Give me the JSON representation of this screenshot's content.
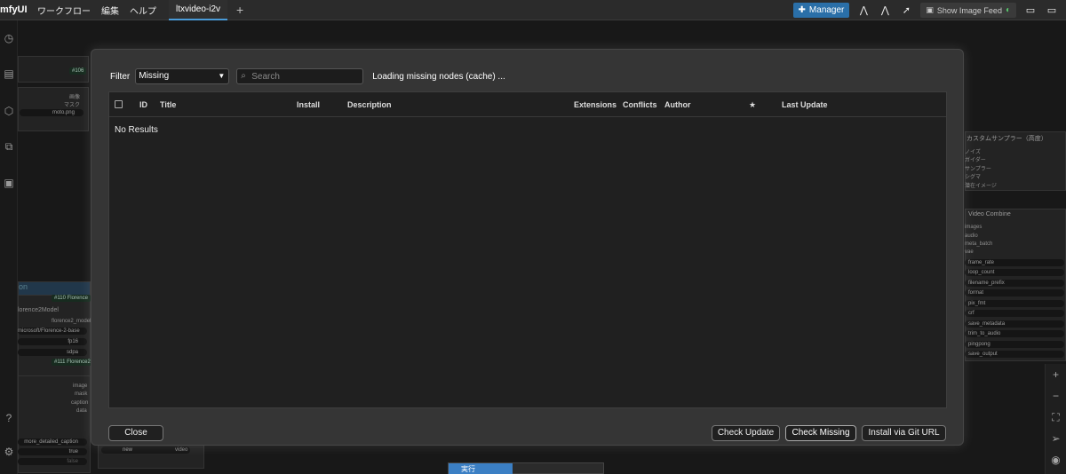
{
  "app": {
    "logo": "mfyUI"
  },
  "menu": [
    "ワークフロー",
    "編集",
    "ヘルプ"
  ],
  "tabs": [
    {
      "label": "ltxvideo-i2v"
    }
  ],
  "toolbar": {
    "manager_label": "Manager",
    "feed_label": "Show Image Feed"
  },
  "background_nodes": {
    "id_106": "#106",
    "image_label": "画像",
    "mask_label": "マスク",
    "file_value": "moto.png",
    "node_partial_title": "on",
    "id_110": "#110 Florence",
    "florence_title": "lorence2Model",
    "florence_model_label": "florence2_model",
    "florence_model_value": "microsoft/Florence-2-base",
    "fp_value": "fp16",
    "attn_value": "sdpa",
    "id_111": "#111 Florence2",
    "out_image": "image",
    "out_mask": "mask",
    "out_caption": "caption",
    "out_data": "data",
    "caption_value": "more_detailed_caption",
    "true_value": "true",
    "false_value": "false",
    "new_label": "new",
    "video_label": "video",
    "sampler_title": "カスタムサンプラー（高度）",
    "sampler_inputs": [
      "ノイズ",
      "ガイダー",
      "サンプラー",
      "シグマ",
      "潜在イメージ"
    ],
    "vc_title": "Video Combine",
    "vc_inputs": [
      "images",
      "audio",
      "meta_batch",
      "vae"
    ],
    "vc_widgets": [
      "frame_rate",
      "loop_count",
      "filename_prefix",
      "format",
      "pix_fmt",
      "crf",
      "save_metadata",
      "trim_to_audio",
      "pingpong",
      "save_output"
    ]
  },
  "dialog": {
    "filter_label": "Filter",
    "filter_value": "Missing",
    "search_placeholder": "Search",
    "loading_text": "Loading missing nodes (cache) ...",
    "columns": {
      "id": "ID",
      "title": "Title",
      "install": "Install",
      "description": "Description",
      "extensions": "Extensions",
      "conflicts": "Conflicts",
      "author": "Author",
      "star": "★",
      "last_update": "Last Update"
    },
    "no_results": "No Results",
    "buttons": {
      "close": "Close",
      "check_update": "Check Update",
      "check_missing": "Check Missing",
      "install_git": "Install via Git URL"
    }
  },
  "queue": {
    "run_label": "実行"
  }
}
